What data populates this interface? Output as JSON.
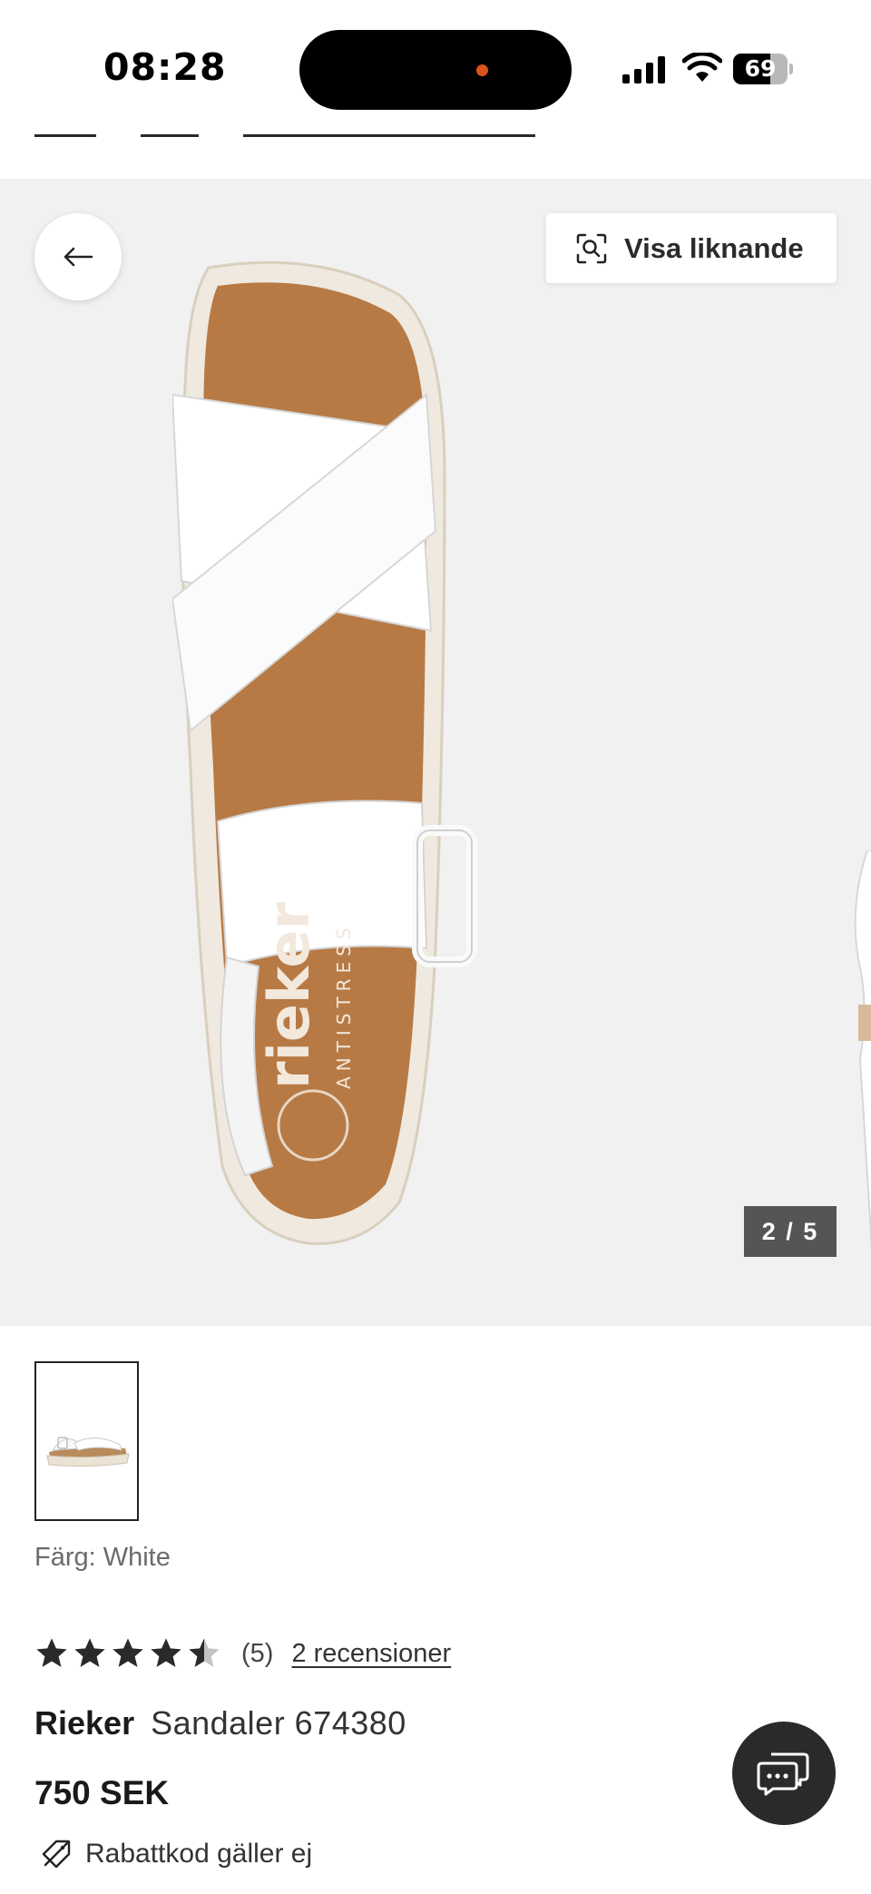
{
  "status_bar": {
    "time": "08:28",
    "battery_level": "69",
    "battery_fraction": 0.69,
    "icons": [
      "signal-icon",
      "wifi-icon",
      "battery-icon"
    ]
  },
  "gallery": {
    "back_icon": "arrow-left-icon",
    "similar_icon": "visual-search-icon",
    "similar_label": "Visa liknande",
    "counter": "2 / 5",
    "image_brand_print": "rieker",
    "image_sub_print": "ANTISTRESS"
  },
  "product": {
    "color_line": "Färg: White",
    "rating": {
      "value": 4.5,
      "max": 5,
      "count_label": "(5)",
      "reviews_link": "2 recensioner"
    },
    "brand": "Rieker",
    "model": "Sandaler 674380",
    "price": "750 SEK",
    "discount_note": "Rabattkod gäller ej",
    "discount_icon": "no-discount-tag-icon"
  },
  "chat": {
    "icon": "chat-bubbles-icon"
  },
  "colors": {
    "gallery_bg": "#f1f1f1",
    "counter_bg": "#555555",
    "chat_bg": "#2a2a2a",
    "island_dot": "#d9541a"
  }
}
